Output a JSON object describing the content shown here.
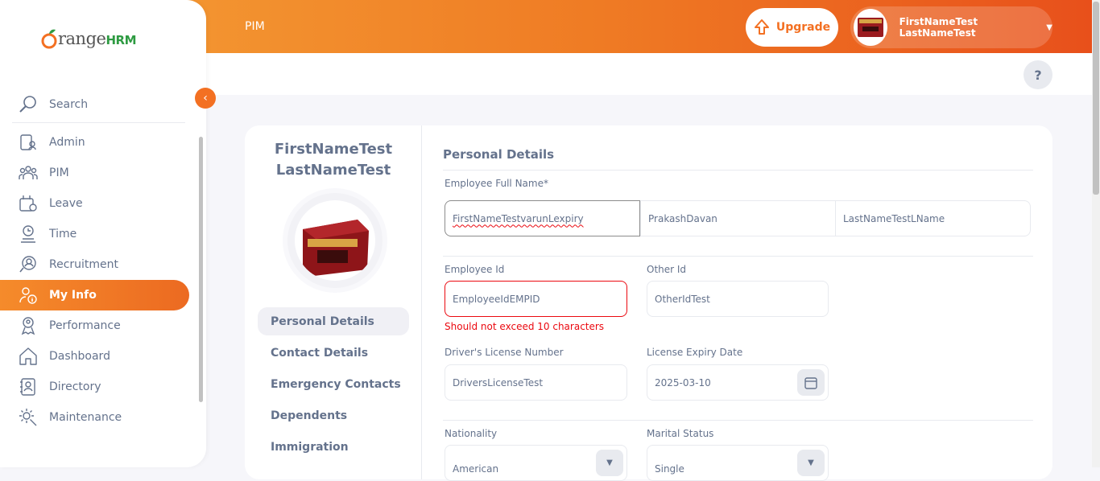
{
  "brand": {
    "logo_text_1": "range",
    "logo_text_2": "HRM"
  },
  "sidebar": {
    "search_label": "Search",
    "collapse_icon": "chevron-left-icon",
    "items": [
      {
        "label": "Admin",
        "icon": "admin-icon"
      },
      {
        "label": "PIM",
        "icon": "pim-icon"
      },
      {
        "label": "Leave",
        "icon": "leave-icon"
      },
      {
        "label": "Time",
        "icon": "time-icon"
      },
      {
        "label": "Recruitment",
        "icon": "recruitment-icon"
      },
      {
        "label": "My Info",
        "icon": "my-info-icon",
        "active": true
      },
      {
        "label": "Performance",
        "icon": "performance-icon"
      },
      {
        "label": "Dashboard",
        "icon": "dashboard-icon"
      },
      {
        "label": "Directory",
        "icon": "directory-icon"
      },
      {
        "label": "Maintenance",
        "icon": "maintenance-icon"
      }
    ]
  },
  "header": {
    "module_title": "PIM",
    "upgrade_label": "Upgrade",
    "user_name": "FirstNameTest LastNameTest",
    "help_label": "?"
  },
  "profile": {
    "first_name": "FirstNameTest",
    "last_name": "LastNameTest",
    "tabs": [
      "Personal Details",
      "Contact Details",
      "Emergency Contacts",
      "Dependents",
      "Immigration"
    ],
    "active_tab": "Personal Details"
  },
  "form": {
    "section_title": "Personal Details",
    "full_name_label": "Employee Full Name*",
    "first_name_value": "FirstNameTestvarunLexpiry",
    "middle_name_value": "PrakashDavan",
    "last_name_value": "LastNameTestLName",
    "employee_id_label": "Employee Id",
    "employee_id_value": "EmployeeIdEMPID",
    "employee_id_error": "Should not exceed 10 characters",
    "other_id_label": "Other Id",
    "other_id_value": "OtherIdTest",
    "license_label": "Driver's License Number",
    "license_value": "DriversLicenseTest",
    "license_expiry_label": "License Expiry Date",
    "license_expiry_value": "2025-03-10",
    "nationality_label": "Nationality",
    "nationality_value": "American",
    "marital_label": "Marital Status",
    "marital_value": "Single"
  },
  "colors": {
    "accent": "#f37022",
    "error": "#eb0910",
    "text": "#64728c"
  }
}
